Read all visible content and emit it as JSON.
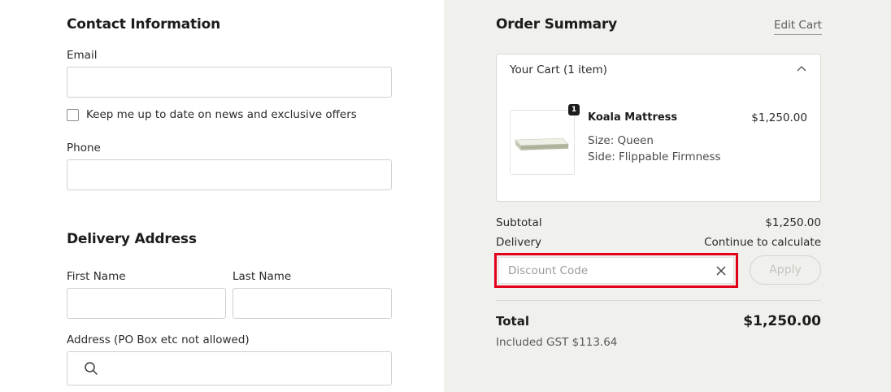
{
  "contact": {
    "title": "Contact Information",
    "email_label": "Email",
    "email_value": "",
    "newsletter_label": "Keep me up to date on news and exclusive offers",
    "newsletter_checked": false,
    "phone_label": "Phone",
    "phone_value": ""
  },
  "delivery": {
    "title": "Delivery Address",
    "first_name_label": "First Name",
    "last_name_label": "Last Name",
    "address_label": "Address (PO Box etc not allowed)",
    "address_icon": "search-icon"
  },
  "summary": {
    "title": "Order Summary",
    "edit_cart_label": "Edit Cart",
    "cart_header": "Your Cart (1 item)",
    "cart_toggle_icon": "chevron-up-icon",
    "item": {
      "quantity": "1",
      "name": "Koala Mattress",
      "size": "Size: Queen",
      "side": "Side: Flippable Firmness",
      "price": "$1,250.00"
    },
    "subtotal_label": "Subtotal",
    "subtotal_value": "$1,250.00",
    "delivery_label": "Delivery",
    "delivery_value": "Continue to calculate",
    "discount_placeholder": "Discount Code",
    "discount_clear_icon": "close-icon",
    "apply_label": "Apply",
    "total_label": "Total",
    "total_value": "$1,250.00",
    "gst_text": "Included GST $113.64"
  },
  "colors": {
    "summary_bg": "#f0f0ec",
    "highlight": "#e2001a",
    "text": "#1c1c1c"
  }
}
